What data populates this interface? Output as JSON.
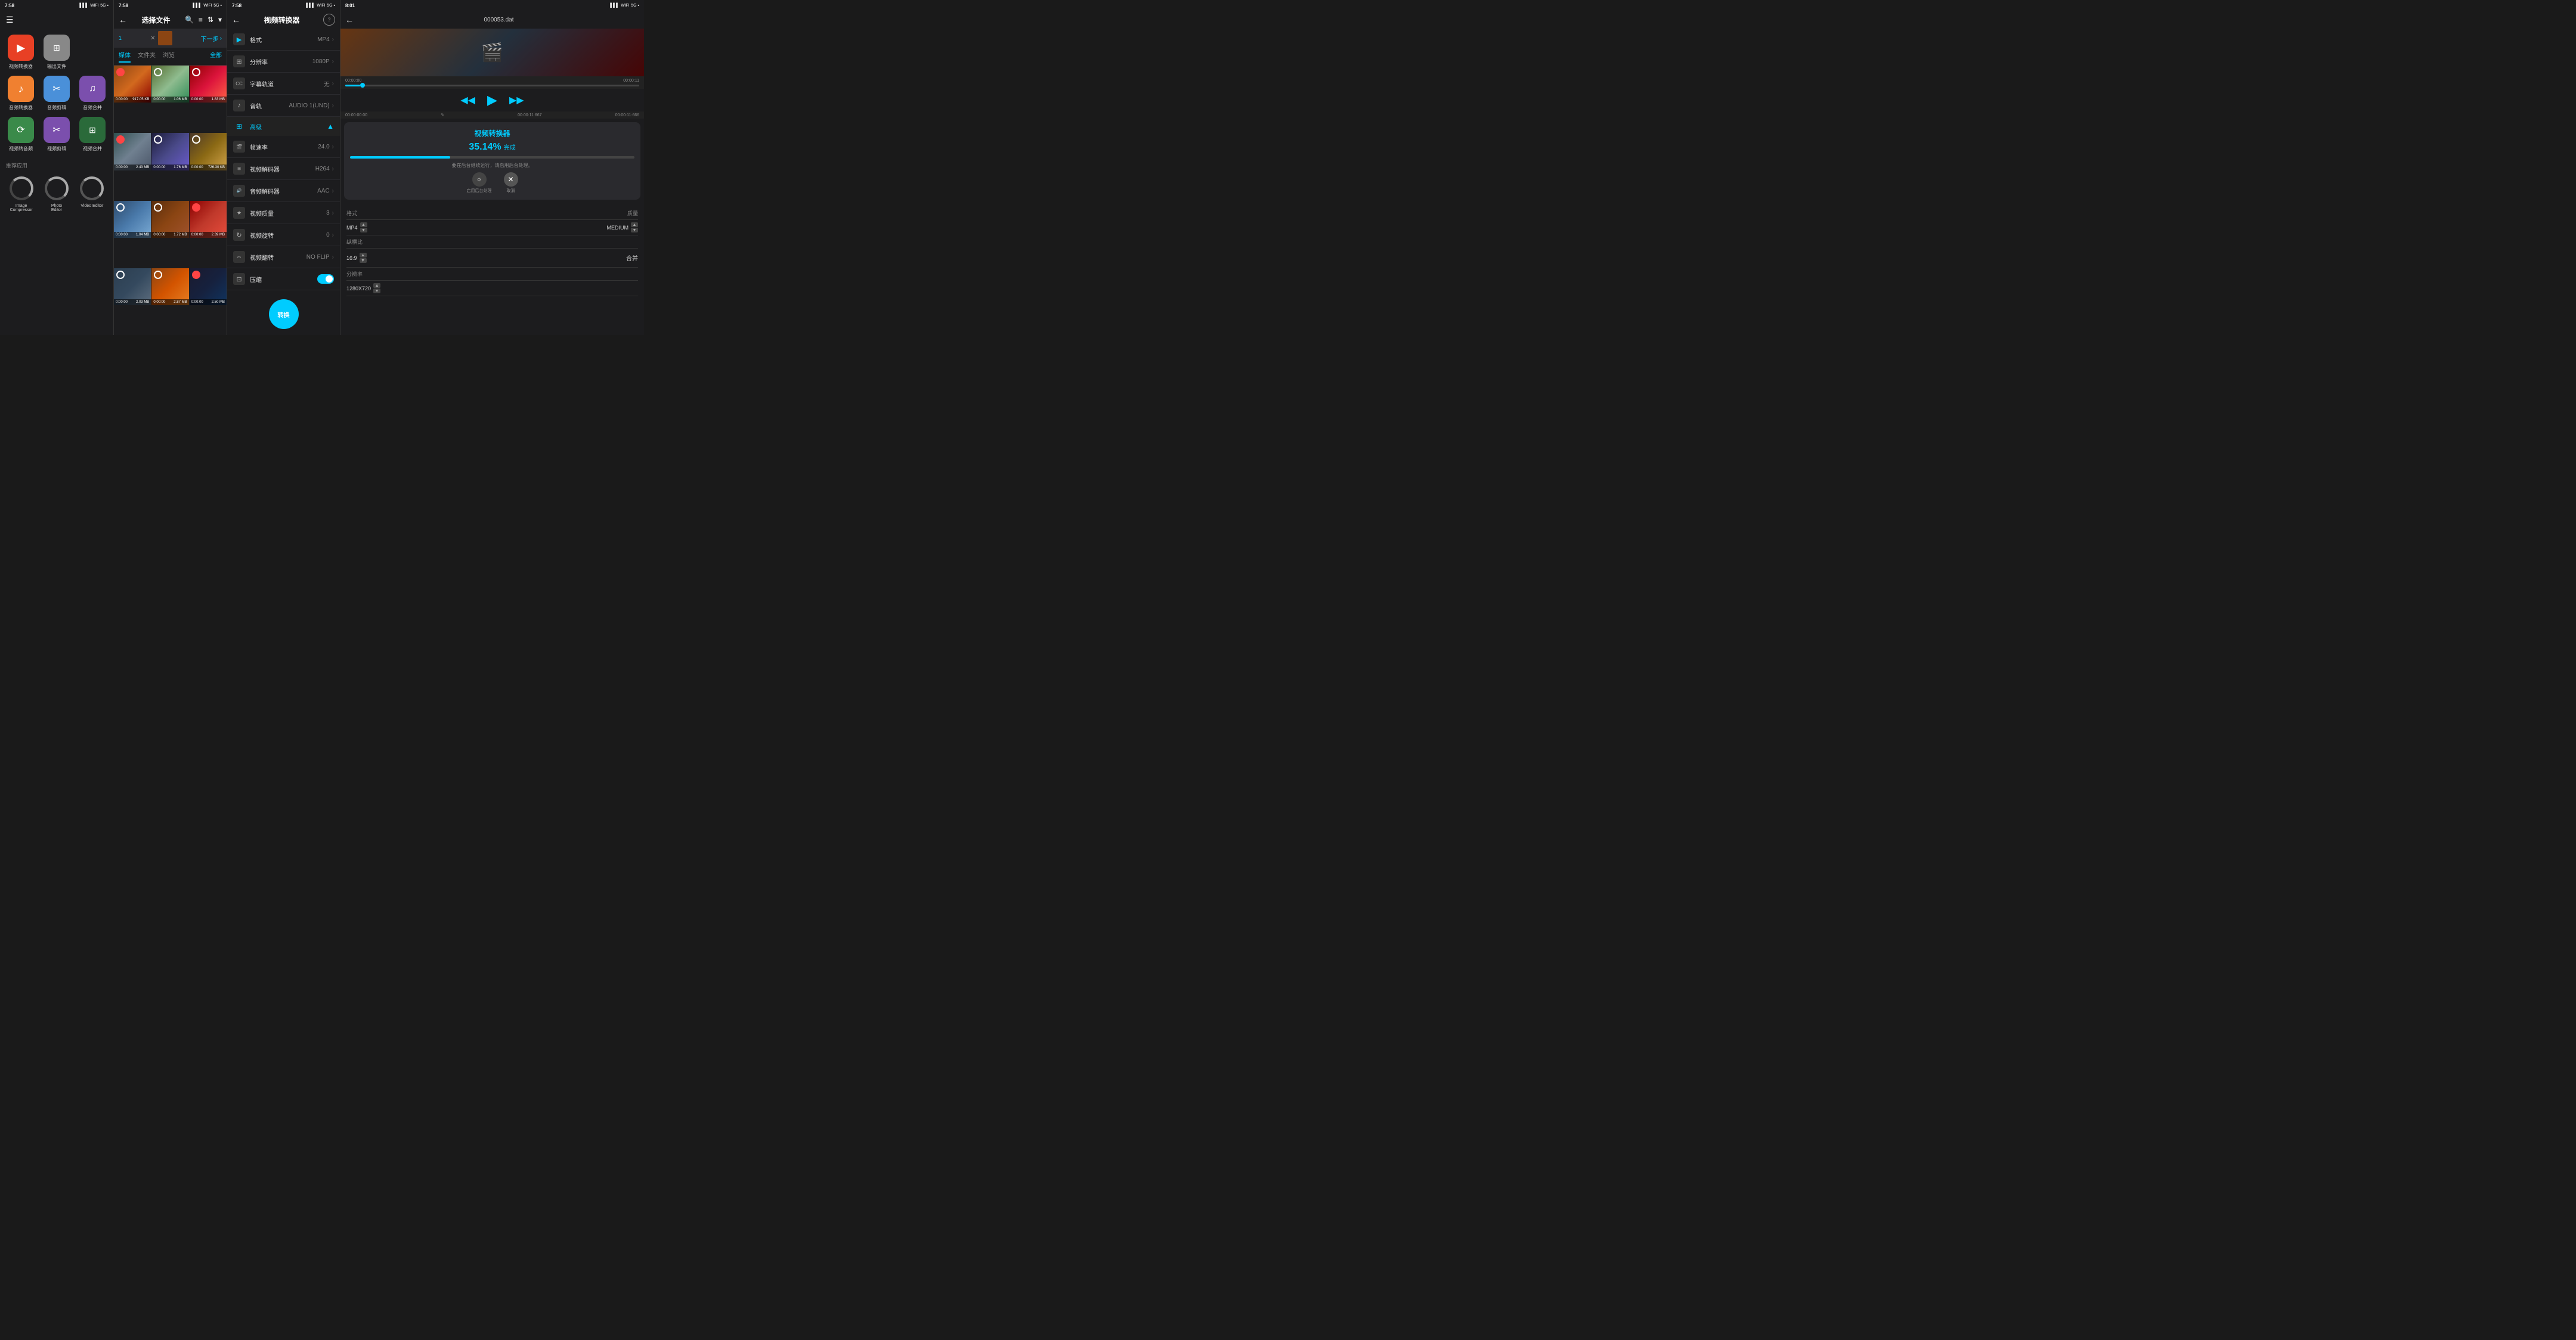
{
  "panel1": {
    "status": {
      "time": "7:58",
      "signal": "|||",
      "wifi": "WiFi",
      "battery": "5G"
    },
    "title": "☰",
    "apps": [
      {
        "id": "video-converter",
        "label": "视频转换器",
        "color": "#e84025",
        "icon": "▶"
      },
      {
        "id": "output-files",
        "label": "输出文件",
        "color": "#555",
        "icon": "⊞"
      },
      {
        "id": "audio-converter",
        "label": "音频转换器",
        "color": "#f08030",
        "icon": "♪"
      },
      {
        "id": "audio-editor",
        "label": "音频剪辑",
        "color": "#4a90d9",
        "icon": "✂"
      },
      {
        "id": "audio-merge",
        "label": "音频合并",
        "color": "#7b4fad",
        "icon": "♫"
      },
      {
        "id": "video-to-audio",
        "label": "视频转音频",
        "color": "#3a8a4a",
        "icon": "⟳"
      },
      {
        "id": "video-editor",
        "label": "视频剪辑",
        "color": "#7b4fad",
        "icon": "✂"
      },
      {
        "id": "video-merge",
        "label": "视频合并",
        "color": "#2a6a3a",
        "icon": "⊞"
      }
    ],
    "recommended_label": "推荐应用",
    "recommended": [
      {
        "id": "image-compressor",
        "label": "Image\nCompressor"
      },
      {
        "id": "photo-editor",
        "label": "Photo\nEditor"
      },
      {
        "id": "video-editor-rec",
        "label": "Video Editor"
      }
    ]
  },
  "panel2": {
    "status": {
      "time": "7:58"
    },
    "title": "选择文件",
    "icons": {
      "search": "🔍",
      "list": "≡",
      "filter": "⇅",
      "more": "▾"
    },
    "selected_count": "1",
    "next_label": "下一步",
    "tabs": [
      {
        "id": "media",
        "label": "媒体",
        "active": true
      },
      {
        "id": "folder",
        "label": "文件夹",
        "active": false
      },
      {
        "id": "browse",
        "label": "浏览",
        "active": false
      }
    ],
    "all_label": "全部",
    "videos": [
      {
        "id": "v1",
        "time": "0:00:00",
        "size": "917.05 KB",
        "color": "vt1",
        "selected": true
      },
      {
        "id": "v2",
        "time": "0:00:00",
        "size": "1.06 MB",
        "color": "vt2",
        "selected": false
      },
      {
        "id": "v3",
        "time": "0:00:00",
        "size": "1.83 MB",
        "color": "vt3",
        "selected": false
      },
      {
        "id": "v4",
        "time": "0:00:00",
        "size": "2.43 MB",
        "color": "vt4",
        "selected": true
      },
      {
        "id": "v5",
        "time": "0:00:00",
        "size": "1.76 MB",
        "color": "vt5",
        "selected": false
      },
      {
        "id": "v6",
        "time": "0:00:00",
        "size": "726.30 KB",
        "color": "vt6",
        "selected": false
      },
      {
        "id": "v7",
        "time": "0:00:00",
        "size": "1.04 MB",
        "color": "vt7",
        "selected": false
      },
      {
        "id": "v8",
        "time": "0:00:00",
        "size": "1.72 MB",
        "color": "vt8",
        "selected": false
      },
      {
        "id": "v9",
        "time": "0:00:00",
        "size": "2.39 MB",
        "color": "vt9",
        "selected": true
      },
      {
        "id": "v10",
        "time": "0:00:00",
        "size": "2.03 MB",
        "color": "vt10",
        "selected": false
      },
      {
        "id": "v11",
        "time": "0:00:00",
        "size": "2.87 MB",
        "color": "vt11",
        "selected": false
      },
      {
        "id": "v12",
        "time": "0:00:00",
        "size": "2.50 MB",
        "color": "vt12",
        "selected": true
      }
    ]
  },
  "panel3": {
    "status": {
      "time": "7:58"
    },
    "title": "视频转换器",
    "help_icon": "?",
    "settings": [
      {
        "id": "format",
        "icon": "▶",
        "label": "格式",
        "value": "MP4"
      },
      {
        "id": "resolution",
        "icon": "⊞",
        "label": "分辨率",
        "value": "1080P"
      },
      {
        "id": "subtitle",
        "icon": "CC",
        "label": "字幕轨道",
        "value": "无"
      },
      {
        "id": "audio",
        "icon": "♪",
        "label": "音轨",
        "value": "AUDIO 1(UND)"
      }
    ],
    "advanced_label": "高级",
    "advanced_settings": [
      {
        "id": "fps",
        "icon": "🎬",
        "label": "帧速率",
        "value": "24.0"
      },
      {
        "id": "video-codec",
        "icon": "⊞",
        "label": "视频解码器",
        "value": "H264"
      },
      {
        "id": "audio-codec",
        "icon": "🔊",
        "label": "音频解码器",
        "value": "AAC"
      },
      {
        "id": "video-quality",
        "icon": "★",
        "label": "视频质量",
        "value": "3"
      },
      {
        "id": "video-rotate",
        "icon": "↻",
        "label": "视频旋转",
        "value": "0"
      },
      {
        "id": "video-flip",
        "icon": "⇔",
        "label": "视频翻转",
        "value": "NO FLIP"
      },
      {
        "id": "compress",
        "icon": "⊡",
        "label": "压缩",
        "value": ""
      }
    ],
    "convert_label": "转换"
  },
  "panel4": {
    "status": {
      "time": "8:01"
    },
    "title": "000053.dat",
    "back_icon": "←",
    "timeline": {
      "start": "00:00:00",
      "end": "00:00:11",
      "progress_percent": 5
    },
    "sub_timeline": {
      "start": "00:00:00:00",
      "edit_icon": "✎",
      "current": "00:00:11:667",
      "end": "00:00:11:666"
    },
    "controls": {
      "rewind": "◀◀",
      "play": "▶",
      "forward": "▶▶"
    },
    "progress_modal": {
      "title": "视频转换器",
      "percent": "35.14%",
      "percent_label": "完成",
      "note": "要在后台继续运行，请启用后台处理。",
      "bg_process_label": "启用后台处理",
      "cancel_label": "取消"
    },
    "output_settings": {
      "format_label": "格式",
      "quality_label": "质量",
      "format_value": "MP4",
      "quality_value": "MEDIUM",
      "aspect_label": "纵横比",
      "aspect_value": "16:9",
      "merge_label": "合并",
      "resolution_label": "分辨率",
      "resolution_value": "1280X720"
    }
  }
}
